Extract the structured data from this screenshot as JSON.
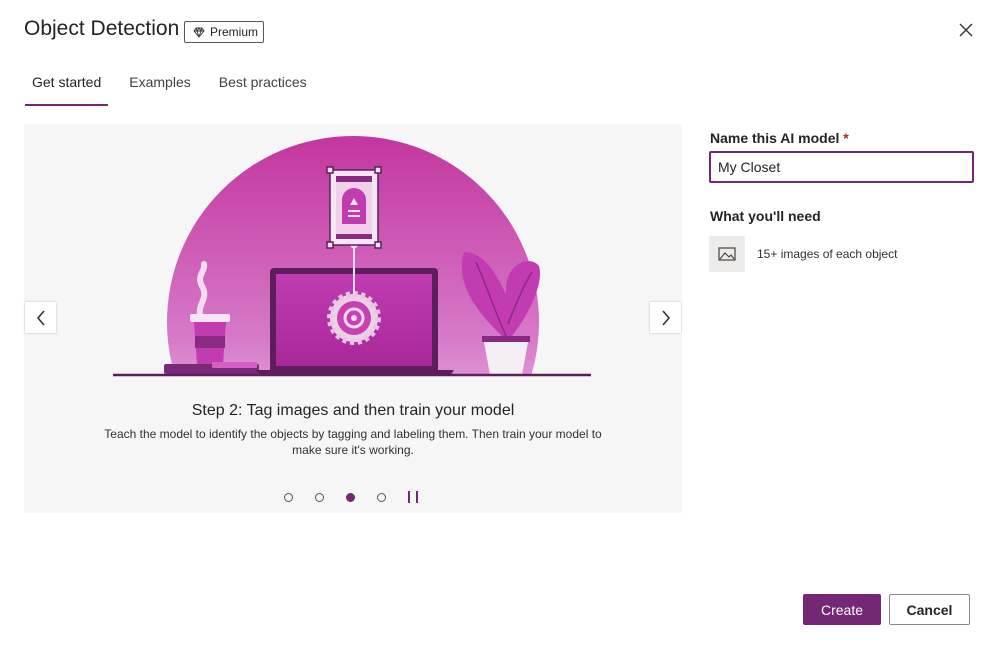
{
  "dialog": {
    "title": "Object Detection",
    "badge_label": "Premium",
    "badge_icon": "diamond-icon",
    "close_icon": "close-icon"
  },
  "tabs": [
    {
      "label": "Get started",
      "active": true
    },
    {
      "label": "Examples",
      "active": false
    },
    {
      "label": "Best practices",
      "active": false
    }
  ],
  "carousel": {
    "step_title": "Step 2: Tag images and then train your model",
    "step_description": "Teach the model to identify the objects by tagging and labeling them. Then train your model to make sure it's working.",
    "prev_icon": "chevron-left-icon",
    "next_icon": "chevron-right-icon",
    "dots_total": 4,
    "active_dot": 3,
    "pause_icon": "pause-icon"
  },
  "form": {
    "name_label": "Name this AI model",
    "required_marker": "*",
    "name_value": "My Closet",
    "need_label": "What you'll need",
    "need_icon": "image-icon",
    "need_item": "15+ images of each object"
  },
  "actions": {
    "create_label": "Create",
    "cancel_label": "Cancel"
  },
  "colors": {
    "accent": "#742774",
    "illustration_primary": "#c239b3",
    "illustration_dark": "#5c1f5c"
  }
}
